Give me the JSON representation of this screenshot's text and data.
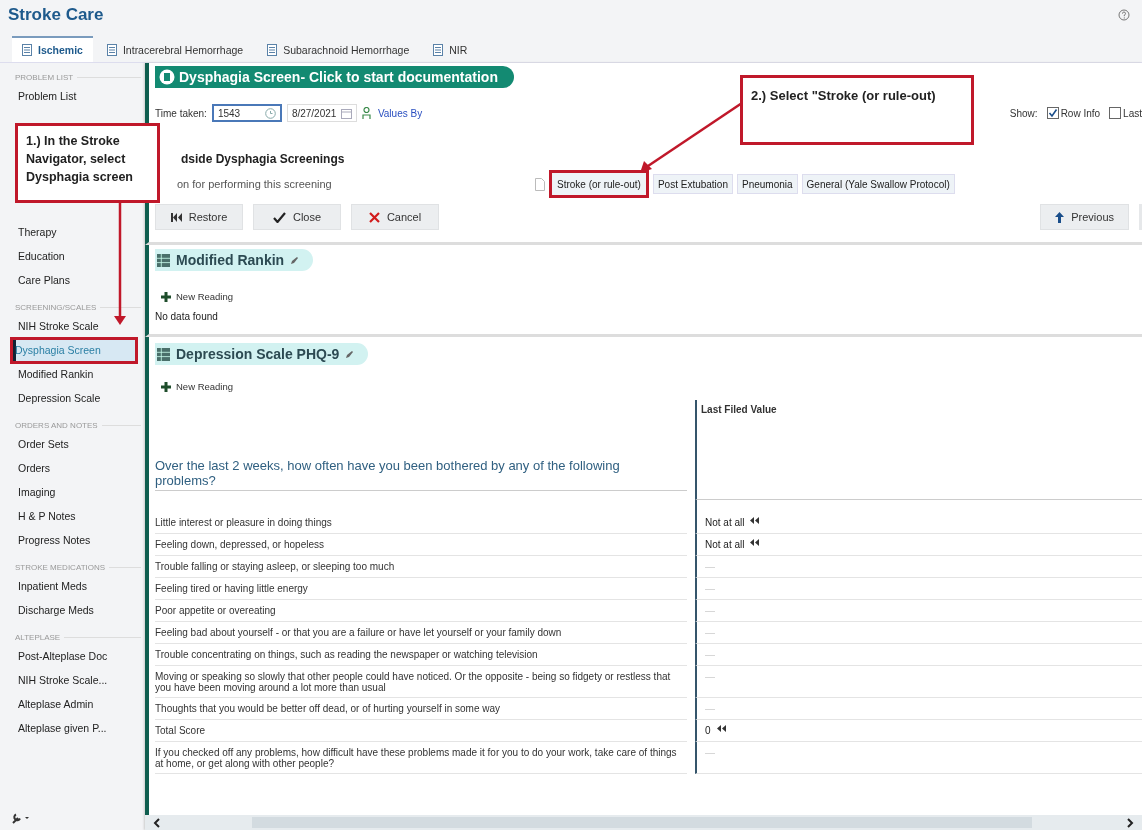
{
  "app": {
    "title": "Stroke Care"
  },
  "tabs": [
    {
      "label": "Ischemic",
      "selected": true
    },
    {
      "label": "Intracerebral Hemorrhage",
      "selected": false
    },
    {
      "label": "Subarachnoid Hemorrhage",
      "selected": false
    },
    {
      "label": "NIR",
      "selected": false
    }
  ],
  "sidebar": {
    "sections": [
      {
        "heading": "PROBLEM LIST",
        "items": [
          {
            "label": "Problem List",
            "selected": false,
            "highlighted": false
          }
        ]
      },
      {
        "items": [
          {
            "label": "Therapy",
            "selected": false,
            "highlighted": false
          },
          {
            "label": "Education",
            "selected": false,
            "highlighted": false
          },
          {
            "label": "Care Plans",
            "selected": false,
            "highlighted": false
          }
        ]
      },
      {
        "heading": "SCREENING/SCALES",
        "items": [
          {
            "label": "NIH Stroke Scale",
            "selected": false,
            "highlighted": false
          },
          {
            "label": "Dysphagia Screen",
            "selected": true,
            "highlighted": true
          },
          {
            "label": "Modified Rankin",
            "selected": false,
            "highlighted": false
          },
          {
            "label": "Depression Scale",
            "selected": false,
            "highlighted": false
          }
        ]
      },
      {
        "heading": "ORDERS AND NOTES",
        "items": [
          {
            "label": "Order Sets",
            "selected": false,
            "highlighted": false
          },
          {
            "label": "Orders",
            "selected": false,
            "highlighted": false
          },
          {
            "label": "Imaging",
            "selected": false,
            "highlighted": false
          },
          {
            "label": "H & P Notes",
            "selected": false,
            "highlighted": false
          },
          {
            "label": "Progress Notes",
            "selected": false,
            "highlighted": false
          }
        ]
      },
      {
        "heading": "STROKE MEDICATIONS",
        "items": [
          {
            "label": "Inpatient Meds",
            "selected": false,
            "highlighted": false
          },
          {
            "label": "Discharge Meds",
            "selected": false,
            "highlighted": false
          }
        ]
      },
      {
        "heading": "ALTEPLASE",
        "items": [
          {
            "label": "Post-Alteplase Doc",
            "selected": false,
            "highlighted": false
          },
          {
            "label": "NIH Stroke Scale...",
            "selected": false,
            "highlighted": false
          },
          {
            "label": "Alteplase Admin",
            "selected": false,
            "highlighted": false
          },
          {
            "label": "Alteplase given P...",
            "selected": false,
            "highlighted": false
          }
        ]
      }
    ]
  },
  "dysphagia": {
    "title": "Dysphagia Screen- Click to start documentation",
    "time_label": "Time taken:",
    "time_value": "1543",
    "date_value": "8/27/2021",
    "values_by": "Values By",
    "show_label": "Show:",
    "show_options": [
      {
        "label": "Row Info",
        "checked": true
      },
      {
        "label": "Last",
        "checked": false
      }
    ],
    "heading": "dside Dysphagia Screenings",
    "subtext": "on for performing this screening",
    "protocols": [
      {
        "label": "Stroke (or rule-out)",
        "highlighted": true
      },
      {
        "label": "Post Extubation",
        "highlighted": false
      },
      {
        "label": "Pneumonia",
        "highlighted": false
      },
      {
        "label": "General (Yale Swallow Protocol)",
        "highlighted": false
      }
    ],
    "buttons": [
      {
        "label": "Restore",
        "kind": "restore"
      },
      {
        "label": "Close",
        "kind": "close"
      },
      {
        "label": "Cancel",
        "kind": "cancel"
      }
    ],
    "previous": "Previous"
  },
  "rankin": {
    "title": "Modified Rankin",
    "new_reading": "New Reading",
    "empty": "No data found"
  },
  "phq9": {
    "title": "Depression Scale PHQ-9",
    "new_reading": "New Reading",
    "value_header": "Last Filed Value",
    "question": "Over the last 2 weeks, how often have you been bothered by any of the following problems?",
    "rows": [
      {
        "label": "Little interest or pleasure in doing things",
        "value": "Not at all",
        "filed": true
      },
      {
        "label": "Feeling down, depressed, or hopeless",
        "value": "Not at all",
        "filed": true
      },
      {
        "label": "Trouble falling or staying asleep, or sleeping too much",
        "value": "—",
        "filed": false
      },
      {
        "label": "Feeling tired or having little energy",
        "value": "—",
        "filed": false
      },
      {
        "label": "Poor appetite or overeating",
        "value": "—",
        "filed": false
      },
      {
        "label": "Feeling bad about yourself - or that you are a failure or have let yourself or your family down",
        "value": "—",
        "filed": false
      },
      {
        "label": "Trouble concentrating on things, such as reading the newspaper or watching television",
        "value": "—",
        "filed": false
      },
      {
        "label": "Moving or speaking so slowly that other people could have noticed. Or the opposite - being so fidgety or restless that you have been moving around a lot more than usual",
        "value": "—",
        "filed": false
      },
      {
        "label": "Thoughts that you would be better off dead, or of hurting yourself in some way",
        "value": "—",
        "filed": false
      },
      {
        "label": "Total Score",
        "value": "0",
        "filed": true
      },
      {
        "label": "If you checked off any problems, how difficult have these problems made it for you to do your work, take care of things at home, or get along with other people?",
        "value": "—",
        "filed": false
      }
    ]
  },
  "callouts": [
    {
      "text": "1.) In the Stroke Navigator, select Dysphagia screen"
    },
    {
      "text": "2.) Select \"Stroke (or rule-out)"
    }
  ]
}
